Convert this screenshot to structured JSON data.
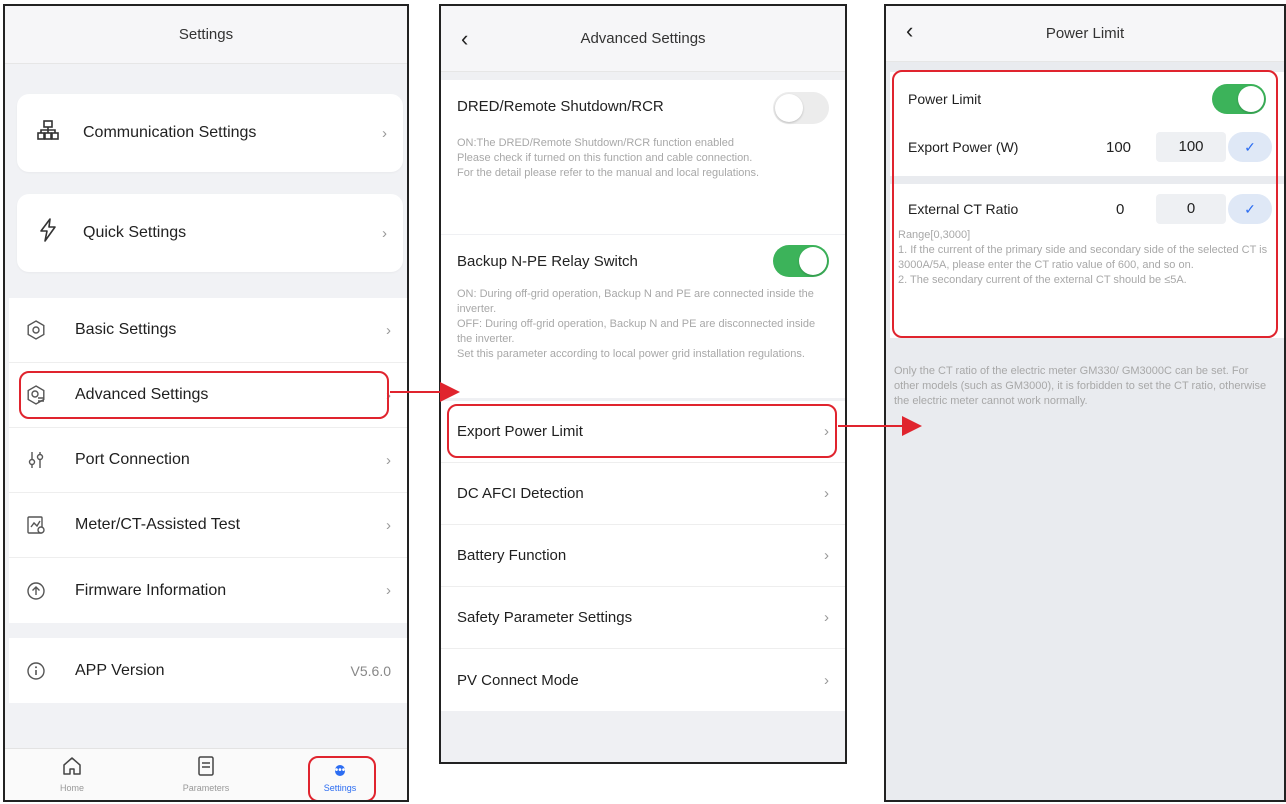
{
  "screen1": {
    "title": "Settings",
    "cards": [
      {
        "label": "Communication Settings",
        "icon": "network-icon"
      },
      {
        "label": "Quick Settings",
        "icon": "lightning-icon"
      }
    ],
    "items": [
      {
        "label": "Basic Settings",
        "icon": "gear-icon"
      },
      {
        "label": "Advanced Settings",
        "icon": "advanced-gear-icon"
      },
      {
        "label": "Port Connection",
        "icon": "port-icon"
      },
      {
        "label": "Meter/CT-Assisted Test",
        "icon": "meter-test-icon"
      },
      {
        "label": "Firmware Information",
        "icon": "upload-icon"
      }
    ],
    "app_version_label": "APP Version",
    "app_version_value": "V5.6.0",
    "tabs": [
      {
        "label": "Home",
        "icon": "home-icon"
      },
      {
        "label": "Parameters",
        "icon": "document-icon"
      },
      {
        "label": "Settings",
        "icon": "more-icon"
      }
    ]
  },
  "screen2": {
    "title": "Advanced Settings",
    "dred_title": "DRED/Remote Shutdown/RCR",
    "dred_desc_1": "ON:The DRED/Remote Shutdown/RCR function enabled",
    "dred_desc_2": "Please check if turned on this function and cable connection.",
    "dred_desc_3": "For the detail please refer to the manual and local regulations.",
    "backup_title": "Backup N-PE Relay Switch",
    "backup_desc_1": "ON: During off-grid operation, Backup N and PE are connected inside the inverter.",
    "backup_desc_2": "OFF: During off-grid operation, Backup N and PE are disconnected inside the inverter.",
    "backup_desc_3": "Set this parameter according to local power grid installation regulations.",
    "rows": [
      "Export Power  Limit",
      "DC AFCI Detection",
      "Battery Function",
      "Safety Parameter Settings",
      "PV Connect Mode"
    ]
  },
  "screen3": {
    "title": "Power Limit",
    "power_limit_label": "Power Limit",
    "export_power_label": "Export Power (W)",
    "export_power_value": "100",
    "export_power_input": "100",
    "ct_ratio_label": "External CT Ratio",
    "ct_ratio_value": "0",
    "ct_ratio_input": "0",
    "range_note_1": "Range[0,3000]",
    "range_note_2": "1. If the current of the primary side and secondary side of the selected CT is 3000A/5A, please enter the CT ratio value of 600, and so on.",
    "range_note_3": "2. The secondary current of the external CT should be ≤5A.",
    "meter_note": "Only the CT ratio of the electric meter GM330/ GM3000C can be set. For other models (such as GM3000), it is forbidden to set the CT ratio, otherwise the electric meter cannot work normally."
  },
  "colors": {
    "highlight": "#e0242e",
    "toggle_on": "#3cb35a",
    "accent": "#2c6df2"
  }
}
